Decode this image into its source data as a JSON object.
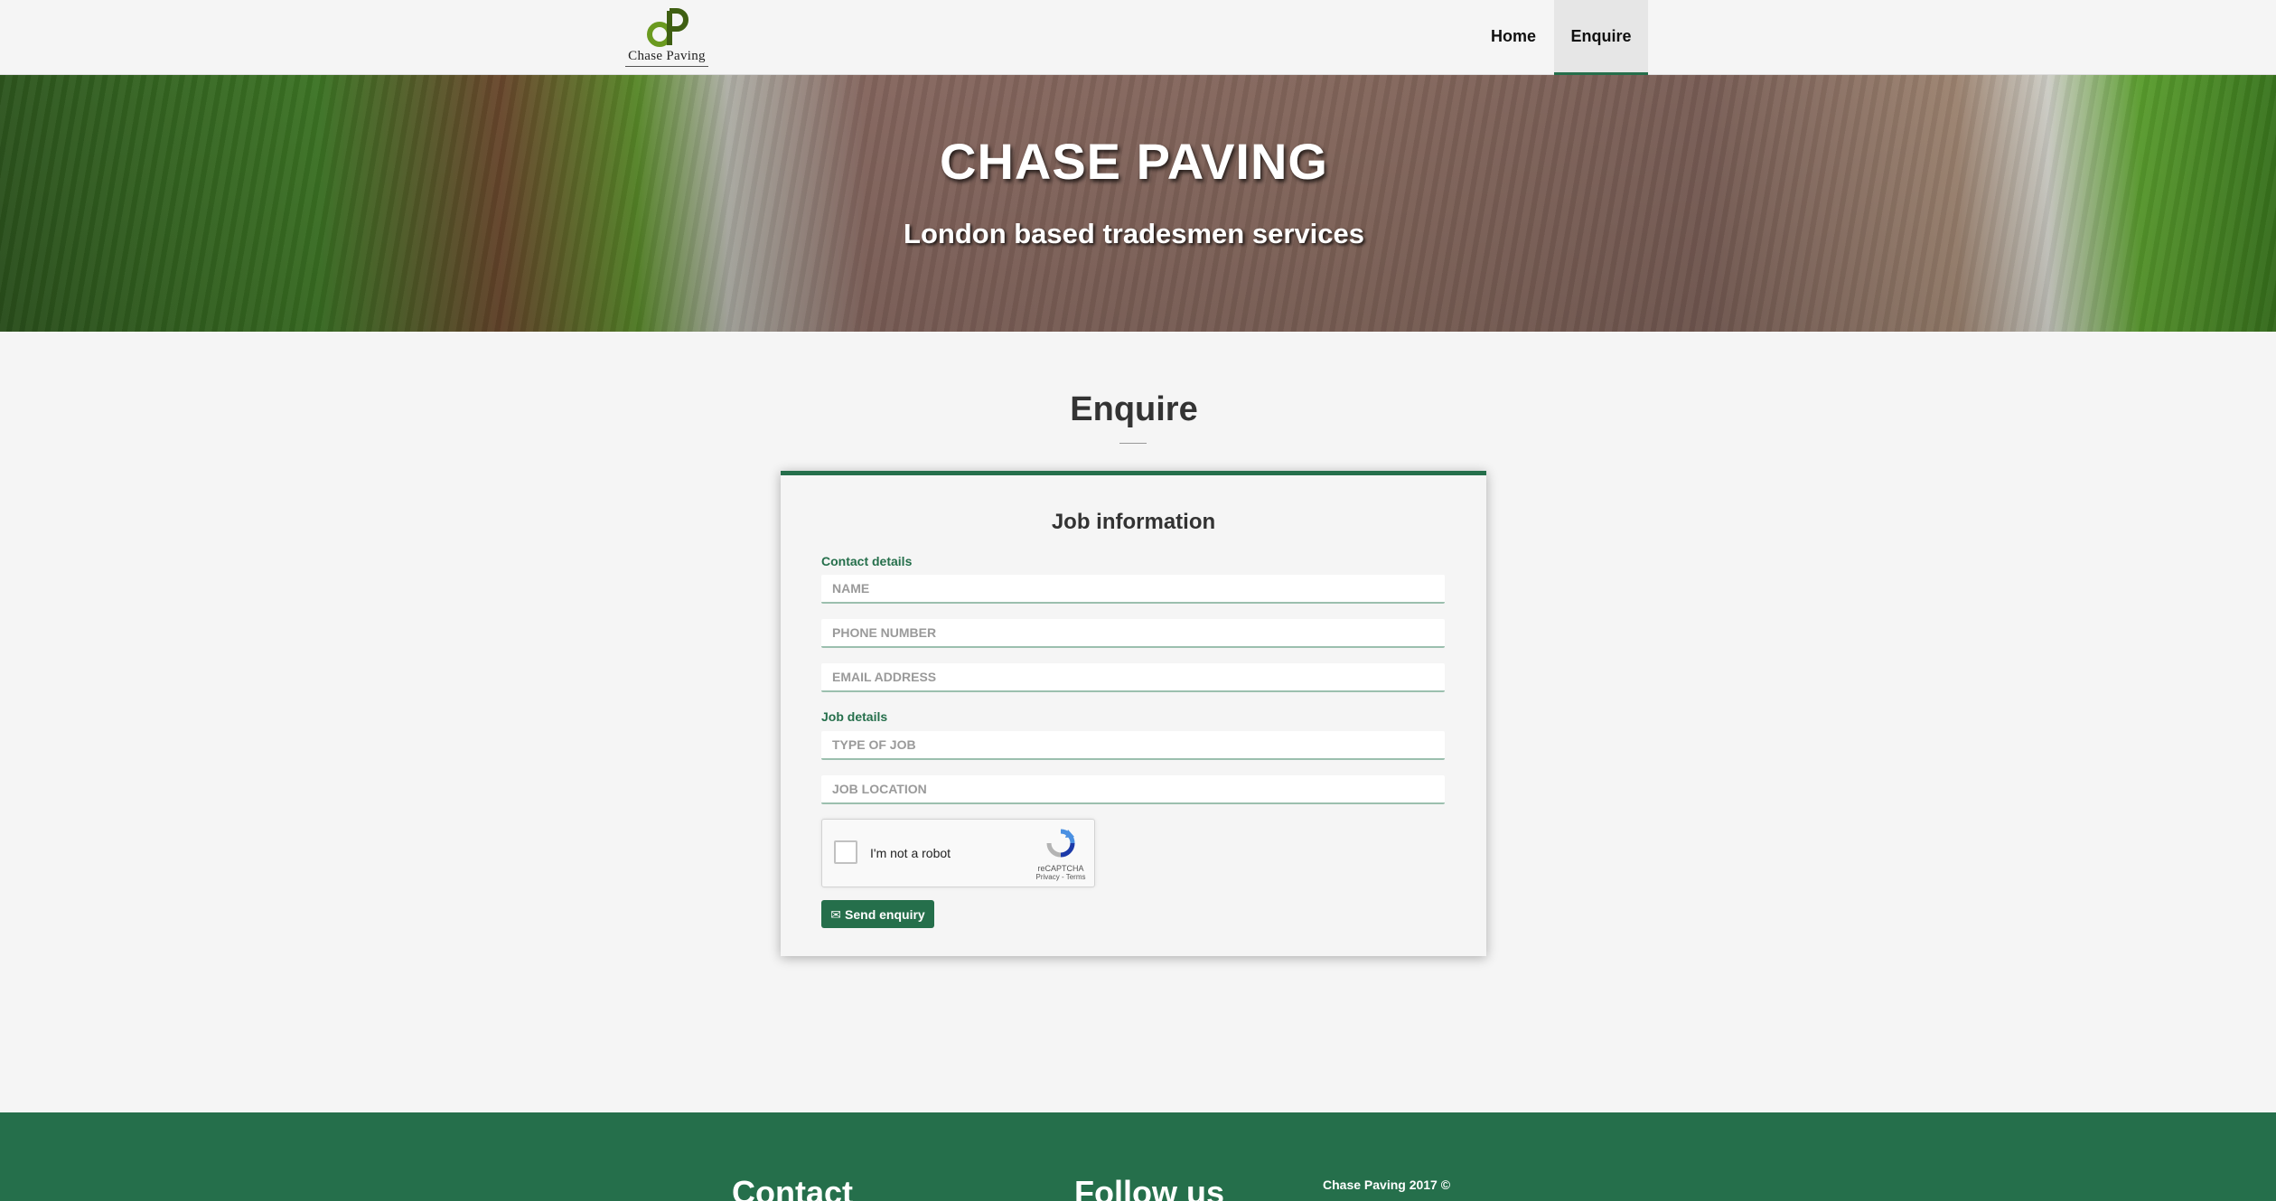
{
  "brand": {
    "logo_text": "Chase Paving"
  },
  "nav": {
    "items": [
      {
        "label": "Home"
      },
      {
        "label": "Enquire"
      }
    ]
  },
  "hero": {
    "title": "CHASE PAVING",
    "subtitle": "London based tradesmen services"
  },
  "section": {
    "title": "Enquire"
  },
  "form": {
    "title": "Job information",
    "contact_label": "Contact details",
    "job_label": "Job details",
    "fields": {
      "name": {
        "placeholder": "NAME",
        "value": ""
      },
      "phone": {
        "placeholder": "PHONE NUMBER",
        "value": ""
      },
      "email": {
        "placeholder": "EMAIL ADDRESS",
        "value": ""
      },
      "job_type": {
        "placeholder": "TYPE OF JOB",
        "value": ""
      },
      "job_location": {
        "placeholder": "JOB LOCATION",
        "value": ""
      }
    },
    "captcha": {
      "label": "I'm not a robot",
      "brand": "reCAPTCHA",
      "links": "Privacy - Terms",
      "checked": false
    },
    "submit_label": "Send enquiry",
    "submit_icon": "envelope-icon"
  },
  "footer": {
    "contact_heading": "Contact",
    "follow_heading": "Follow us",
    "copyright": "Chase Paving 2017 ©"
  },
  "colors": {
    "brand_green": "#256f4b",
    "logo_green": "#6a9a1f",
    "background": "#f5f5f5"
  }
}
